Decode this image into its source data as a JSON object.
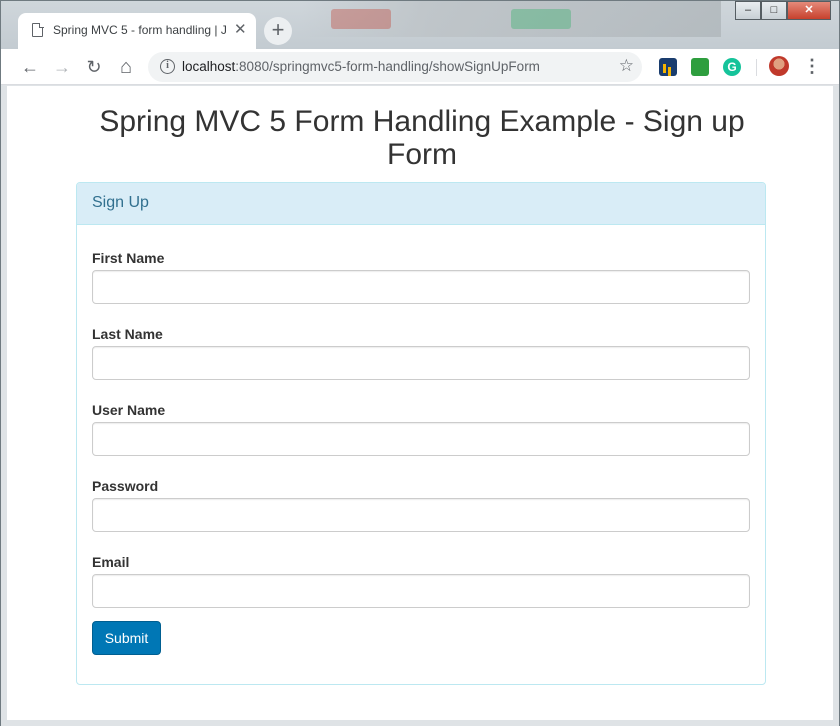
{
  "browser": {
    "tab_title": "Spring MVC 5 - form handling | J",
    "tab_close": "✕",
    "new_tab": "+",
    "url_host": "localhost",
    "url_path": ":8080/springmvc5-form-handling/showSignUpForm",
    "back": "←",
    "forward": "→",
    "reload": "↻",
    "home": "⌂",
    "star": "☆",
    "menu": "⋮",
    "info": "i",
    "grammarly": "G",
    "window_controls": {
      "minimize": "–",
      "maximize": "□",
      "close": "✕"
    }
  },
  "page": {
    "heading": "Spring MVC 5 Form Handling Example - Sign up Form",
    "panel_title": "Sign Up",
    "fields": [
      {
        "label": "First Name",
        "value": "",
        "placeholder": ""
      },
      {
        "label": "Last Name",
        "value": "",
        "placeholder": ""
      },
      {
        "label": "User Name",
        "value": "",
        "placeholder": ""
      },
      {
        "label": "Password",
        "value": "",
        "placeholder": ""
      },
      {
        "label": "Email",
        "value": "",
        "placeholder": ""
      }
    ],
    "submit_label": "Submit"
  },
  "colors": {
    "panel_heading_bg": "#d9edf7",
    "panel_heading_text": "#31708f",
    "panel_border": "#bce8f1",
    "submit_bg": "#0077b5"
  }
}
